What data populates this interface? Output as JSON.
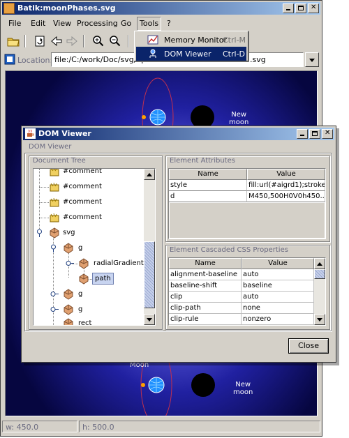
{
  "app": {
    "title": "Batik:moonPhases.svg"
  },
  "menu": {
    "file": "File",
    "edit": "Edit",
    "view": "View",
    "processing": "Processing",
    "go": "Go",
    "tools": "Tools",
    "help": "?"
  },
  "tools_menu": [
    {
      "label": "Memory Monitor",
      "accel": "Ctrl-M",
      "icon": "memory-monitor-icon"
    },
    {
      "label": "DOM Viewer",
      "accel": "Ctrl-D",
      "icon": "dom-viewer-icon"
    }
  ],
  "location": {
    "label": "Location:",
    "value": "file:/C:/work/Doc/svg/apa",
    "value_tail": ".svg"
  },
  "canvas": {
    "new_moon_top": [
      "New",
      "moon"
    ],
    "moon_partial": "Moon",
    "new_moon_bottom": [
      "New",
      "moon"
    ]
  },
  "status": {
    "width": "w: 450.0",
    "height": "h: 500.0"
  },
  "dom_viewer": {
    "title": "DOM Viewer",
    "caption": "DOM Viewer",
    "document_tree_title": "Document Tree",
    "tree": [
      "#comment",
      "#comment",
      "#comment",
      "#comment",
      "svg",
      "g",
      "radialGradient",
      "path",
      "g",
      "g",
      "rect"
    ],
    "element_attributes_title": "Element Attributes",
    "attr_headers": {
      "name": "Name",
      "value": "Value"
    },
    "attributes": [
      {
        "name": "style",
        "value": "fill:url(#aigrd1);stroke..."
      },
      {
        "name": "d",
        "value": "M450,500H0V0h450..."
      }
    ],
    "css_title": "Element Cascaded CSS Properties",
    "css_headers": {
      "name": "Name",
      "value": "Value"
    },
    "css": [
      {
        "name": "alignment-baseline",
        "value": "auto"
      },
      {
        "name": "baseline-shift",
        "value": "baseline"
      },
      {
        "name": "clip",
        "value": "auto"
      },
      {
        "name": "clip-path",
        "value": "none"
      },
      {
        "name": "clip-rule",
        "value": "nonzero"
      }
    ],
    "close_label": "Close"
  }
}
